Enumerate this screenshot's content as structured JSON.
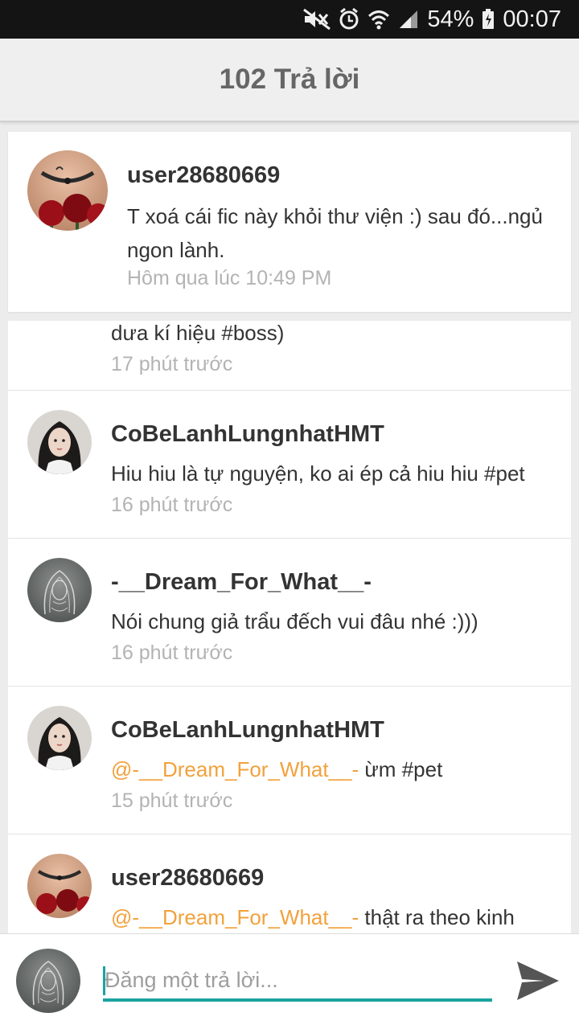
{
  "status_bar": {
    "battery": "54%",
    "time": "00:07",
    "icons": [
      "mute-icon",
      "alarm-icon",
      "wifi-icon",
      "signal-icon",
      "battery-icon"
    ]
  },
  "header": {
    "title": "102 Trả lời"
  },
  "pinned": {
    "username": "user28680669",
    "message": "T xoá cái fic này khỏi thư viện :) sau đó...ngủ ngon lành.",
    "time": "Hôm qua lúc 10:49 PM"
  },
  "replies": [
    {
      "username": "",
      "message": "dưa kí hiệu #boss)",
      "time": "17 phút trước"
    },
    {
      "username": "CoBeLanhLungnhatHMT",
      "mention": "",
      "message": "Hiu hiu là tự nguyện, ko ai ép cả hiu hiu #pet",
      "time": "16 phút trước"
    },
    {
      "username": "-__Dream_For_What__-",
      "mention": "",
      "message": "Nói chung giả trẩu đếch vui đâu nhé :)))",
      "time": "16 phút trước"
    },
    {
      "username": "CoBeLanhLungnhatHMT",
      "mention": "@-__Dream_For_What__-",
      "message": "ừm #pet",
      "time": "15 phút trước"
    },
    {
      "username": "user28680669",
      "mention": "@-__Dream_For_What__-",
      "message": "thật ra theo kinh",
      "time": ""
    }
  ],
  "composer": {
    "placeholder": "Đăng một trả lời..."
  },
  "colors": {
    "accent": "#1aa3a0",
    "mention": "#f2a13c",
    "muted": "#b3b3b3"
  }
}
